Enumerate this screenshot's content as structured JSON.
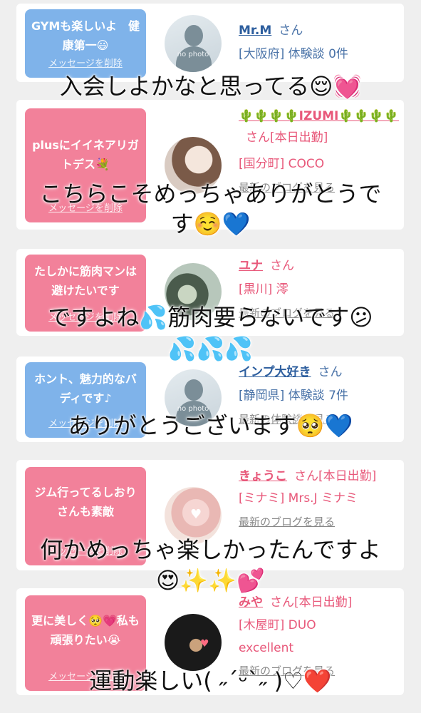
{
  "cards": [
    {
      "message": "GYMも楽しいよ　健康第一😃",
      "delete": "メッセージを削除",
      "name": "Mr.M",
      "suffix": "さん",
      "meta": [
        "[大阪府] 体験談 0件"
      ],
      "no_photo": "no photo"
    },
    {
      "message": "plusにイイネアリガトデス💐",
      "delete": "メッセージを削除",
      "name": "🌵🌵🌵🌵IZUMI🌵🌵🌵🌵",
      "suffix": "さん[本日出勤]",
      "meta": [
        "[国分町] COCO"
      ],
      "blog": "最新のブログを見る"
    },
    {
      "message": "たしかに筋肉マンは避けたいです",
      "delete": "メッセージを削除",
      "name": "ユナ",
      "suffix": "さん",
      "meta": [
        "[黒川] 澪"
      ],
      "blog": "最新のブログを見る"
    },
    {
      "message": "ホント、魅力的なバディです♪",
      "delete": "メッセージを削除",
      "name": "インプ大好き",
      "suffix": "さん",
      "meta": [
        "[静岡県] 体験談 7件"
      ],
      "blog": "最新の体験談を見る",
      "no_photo": "no photo"
    },
    {
      "message": "ジム行ってるしおりさんも素敵",
      "delete": "メッセージを削除",
      "name": "きょうこ",
      "suffix": "さん[本日出勤]",
      "meta": [
        "[ミナミ] Mrs.J ミナミ"
      ],
      "blog": "最新のブログを見る"
    },
    {
      "message": "更に美しく🥺💗私も頑張りたい😭",
      "delete": "メッセージを削除",
      "name": "みや",
      "suffix": "さん[本日出勤]",
      "meta": [
        "[木屋町] DUO",
        "excellent"
      ],
      "blog": "最新のブログを見る"
    }
  ],
  "overlays": [
    "入会しよかなと思ってる😌💓",
    "こちらこそめっちゃありがとうで",
    "す☺️💙",
    "ですよね💦筋肉要らないです😕",
    "💦💦💦",
    "ありがとうございます🥺💙",
    "何かめっちゃ楽しかったんですよ",
    "😍✨✨💕",
    "運動楽しい( ˶ˊᵕˋ˶ )♡❤️"
  ]
}
